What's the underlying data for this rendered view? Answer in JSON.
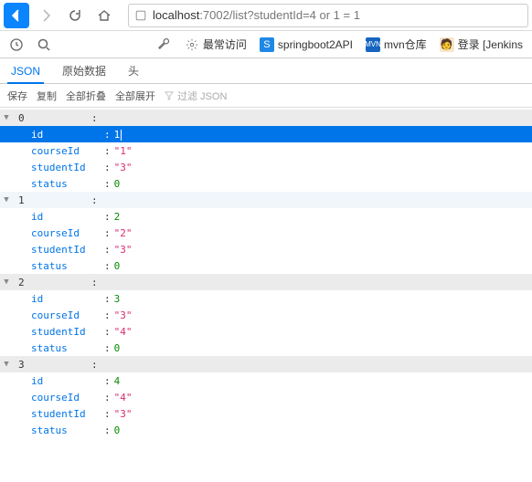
{
  "url": {
    "host": "localhost",
    "port": ":7002",
    "path": "/list?studentId=4 or 1 = 1"
  },
  "bookmarks": {
    "frequent": "最常访问",
    "items": [
      {
        "label": "springboot2API"
      },
      {
        "label": "mvn仓库"
      },
      {
        "label": "登录 [Jenkins"
      }
    ]
  },
  "tabs": {
    "json": "JSON",
    "raw": "原始数据",
    "headers": "头"
  },
  "tools": {
    "save": "保存",
    "copy": "复制",
    "collapseAll": "全部折叠",
    "expandAll": "全部展开",
    "filterPlaceholder": "过滤 JSON"
  },
  "json": [
    {
      "index": "0",
      "id": "1",
      "courseId": "\"1\"",
      "studentId": "\"3\"",
      "status": "0",
      "selected": true
    },
    {
      "index": "1",
      "id": "2",
      "courseId": "\"2\"",
      "studentId": "\"3\"",
      "status": "0",
      "highlight": true
    },
    {
      "index": "2",
      "id": "3",
      "courseId": "\"3\"",
      "studentId": "\"4\"",
      "status": "0"
    },
    {
      "index": "3",
      "id": "4",
      "courseId": "\"4\"",
      "studentId": "\"3\"",
      "status": "0"
    }
  ],
  "keys": {
    "id": "id",
    "courseId": "courseId",
    "studentId": "studentId",
    "status": "status"
  }
}
